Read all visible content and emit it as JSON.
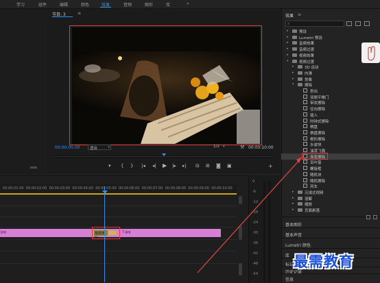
{
  "menu": {
    "items": [
      "学习",
      "组件",
      "编辑",
      "颜色",
      "效果",
      "音频",
      "图形",
      "库"
    ],
    "more": "»"
  },
  "program": {
    "title": "节目: 3",
    "menu_icon": "≡",
    "timecode_current": "00:00:05:00",
    "fit_select": "适合",
    "resolution": "1/2",
    "timecode_total": "00:00:10:00"
  },
  "effects": {
    "title": "效果",
    "menu_icon": "≡",
    "search_placeholder": "",
    "tree": [
      {
        "label": "预设",
        "level": 0,
        "type": "folder",
        "expanded": false
      },
      {
        "label": "Lumetri 预设",
        "level": 0,
        "type": "folder",
        "expanded": false
      },
      {
        "label": "音频效果",
        "level": 0,
        "type": "folder",
        "expanded": false
      },
      {
        "label": "音频过渡",
        "level": 0,
        "type": "folder",
        "expanded": false
      },
      {
        "label": "视频效果",
        "level": 0,
        "type": "folder",
        "expanded": false
      },
      {
        "label": "视频过渡",
        "level": 0,
        "type": "folder",
        "expanded": true
      },
      {
        "label": "3D 运动",
        "level": 1,
        "type": "folder",
        "expanded": false
      },
      {
        "label": "内滑",
        "level": 1,
        "type": "folder",
        "expanded": false
      },
      {
        "label": "划像",
        "level": 1,
        "type": "folder",
        "expanded": false
      },
      {
        "label": "擦除",
        "level": 1,
        "type": "folder",
        "expanded": true
      },
      {
        "label": "划出",
        "level": 2,
        "type": "fx"
      },
      {
        "label": "双侧平推门",
        "level": 2,
        "type": "fx"
      },
      {
        "label": "带状擦除",
        "level": 2,
        "type": "fx"
      },
      {
        "label": "径向擦除",
        "level": 2,
        "type": "fx"
      },
      {
        "label": "插入",
        "level": 2,
        "type": "fx"
      },
      {
        "label": "时钟式擦除",
        "level": 2,
        "type": "fx"
      },
      {
        "label": "棋盘",
        "level": 2,
        "type": "fx"
      },
      {
        "label": "棋盘擦除",
        "level": 2,
        "type": "fx"
      },
      {
        "label": "楔形擦除",
        "level": 2,
        "type": "fx"
      },
      {
        "label": "水波块",
        "level": 2,
        "type": "fx"
      },
      {
        "label": "油漆飞溅",
        "level": 2,
        "type": "fx"
      },
      {
        "label": "渐变擦除",
        "level": 2,
        "type": "fx",
        "selected": true
      },
      {
        "label": "百叶窗",
        "level": 2,
        "type": "fx"
      },
      {
        "label": "螺旋框",
        "level": 2,
        "type": "fx"
      },
      {
        "label": "随机块",
        "level": 2,
        "type": "fx"
      },
      {
        "label": "随机擦除",
        "level": 2,
        "type": "fx"
      },
      {
        "label": "风车",
        "level": 2,
        "type": "fx"
      },
      {
        "label": "沉浸式视频",
        "level": 1,
        "type": "folder",
        "expanded": false
      },
      {
        "label": "溶解",
        "level": 1,
        "type": "folder",
        "expanded": false
      },
      {
        "label": "缩放",
        "level": 1,
        "type": "folder",
        "expanded": false
      },
      {
        "label": "页面剥落",
        "level": 1,
        "type": "folder",
        "expanded": false
      }
    ],
    "panels": [
      "基本图形",
      "基本声音",
      "Lumetri 颜色",
      "库",
      "标记",
      "历史记录",
      "信息"
    ]
  },
  "timeline": {
    "ruler_ticks": [
      "00:00:01:00",
      "00:00:02:00",
      "00:00:03:00",
      "00:00:04:00",
      "00:00:05:00",
      "00:00:06:00",
      "00:00:07:00",
      "00:00:08:00",
      "00:00:09:00",
      "00:00:10:00"
    ],
    "clip_left_label": "jpg",
    "transition_label": "渐变擦除",
    "clip_right_label": "7.jpg"
  },
  "meter": {
    "labels": [
      "0",
      "-6",
      "-12",
      "-18",
      "-24",
      "-30",
      "-36",
      "-42",
      "-48",
      "-54"
    ]
  },
  "watermark": "最需教育",
  "colors": {
    "accent": "#3a8ee6",
    "clip": "#d67fd4",
    "highlight": "#e03a3a",
    "watermark": "#1a4fd6"
  }
}
